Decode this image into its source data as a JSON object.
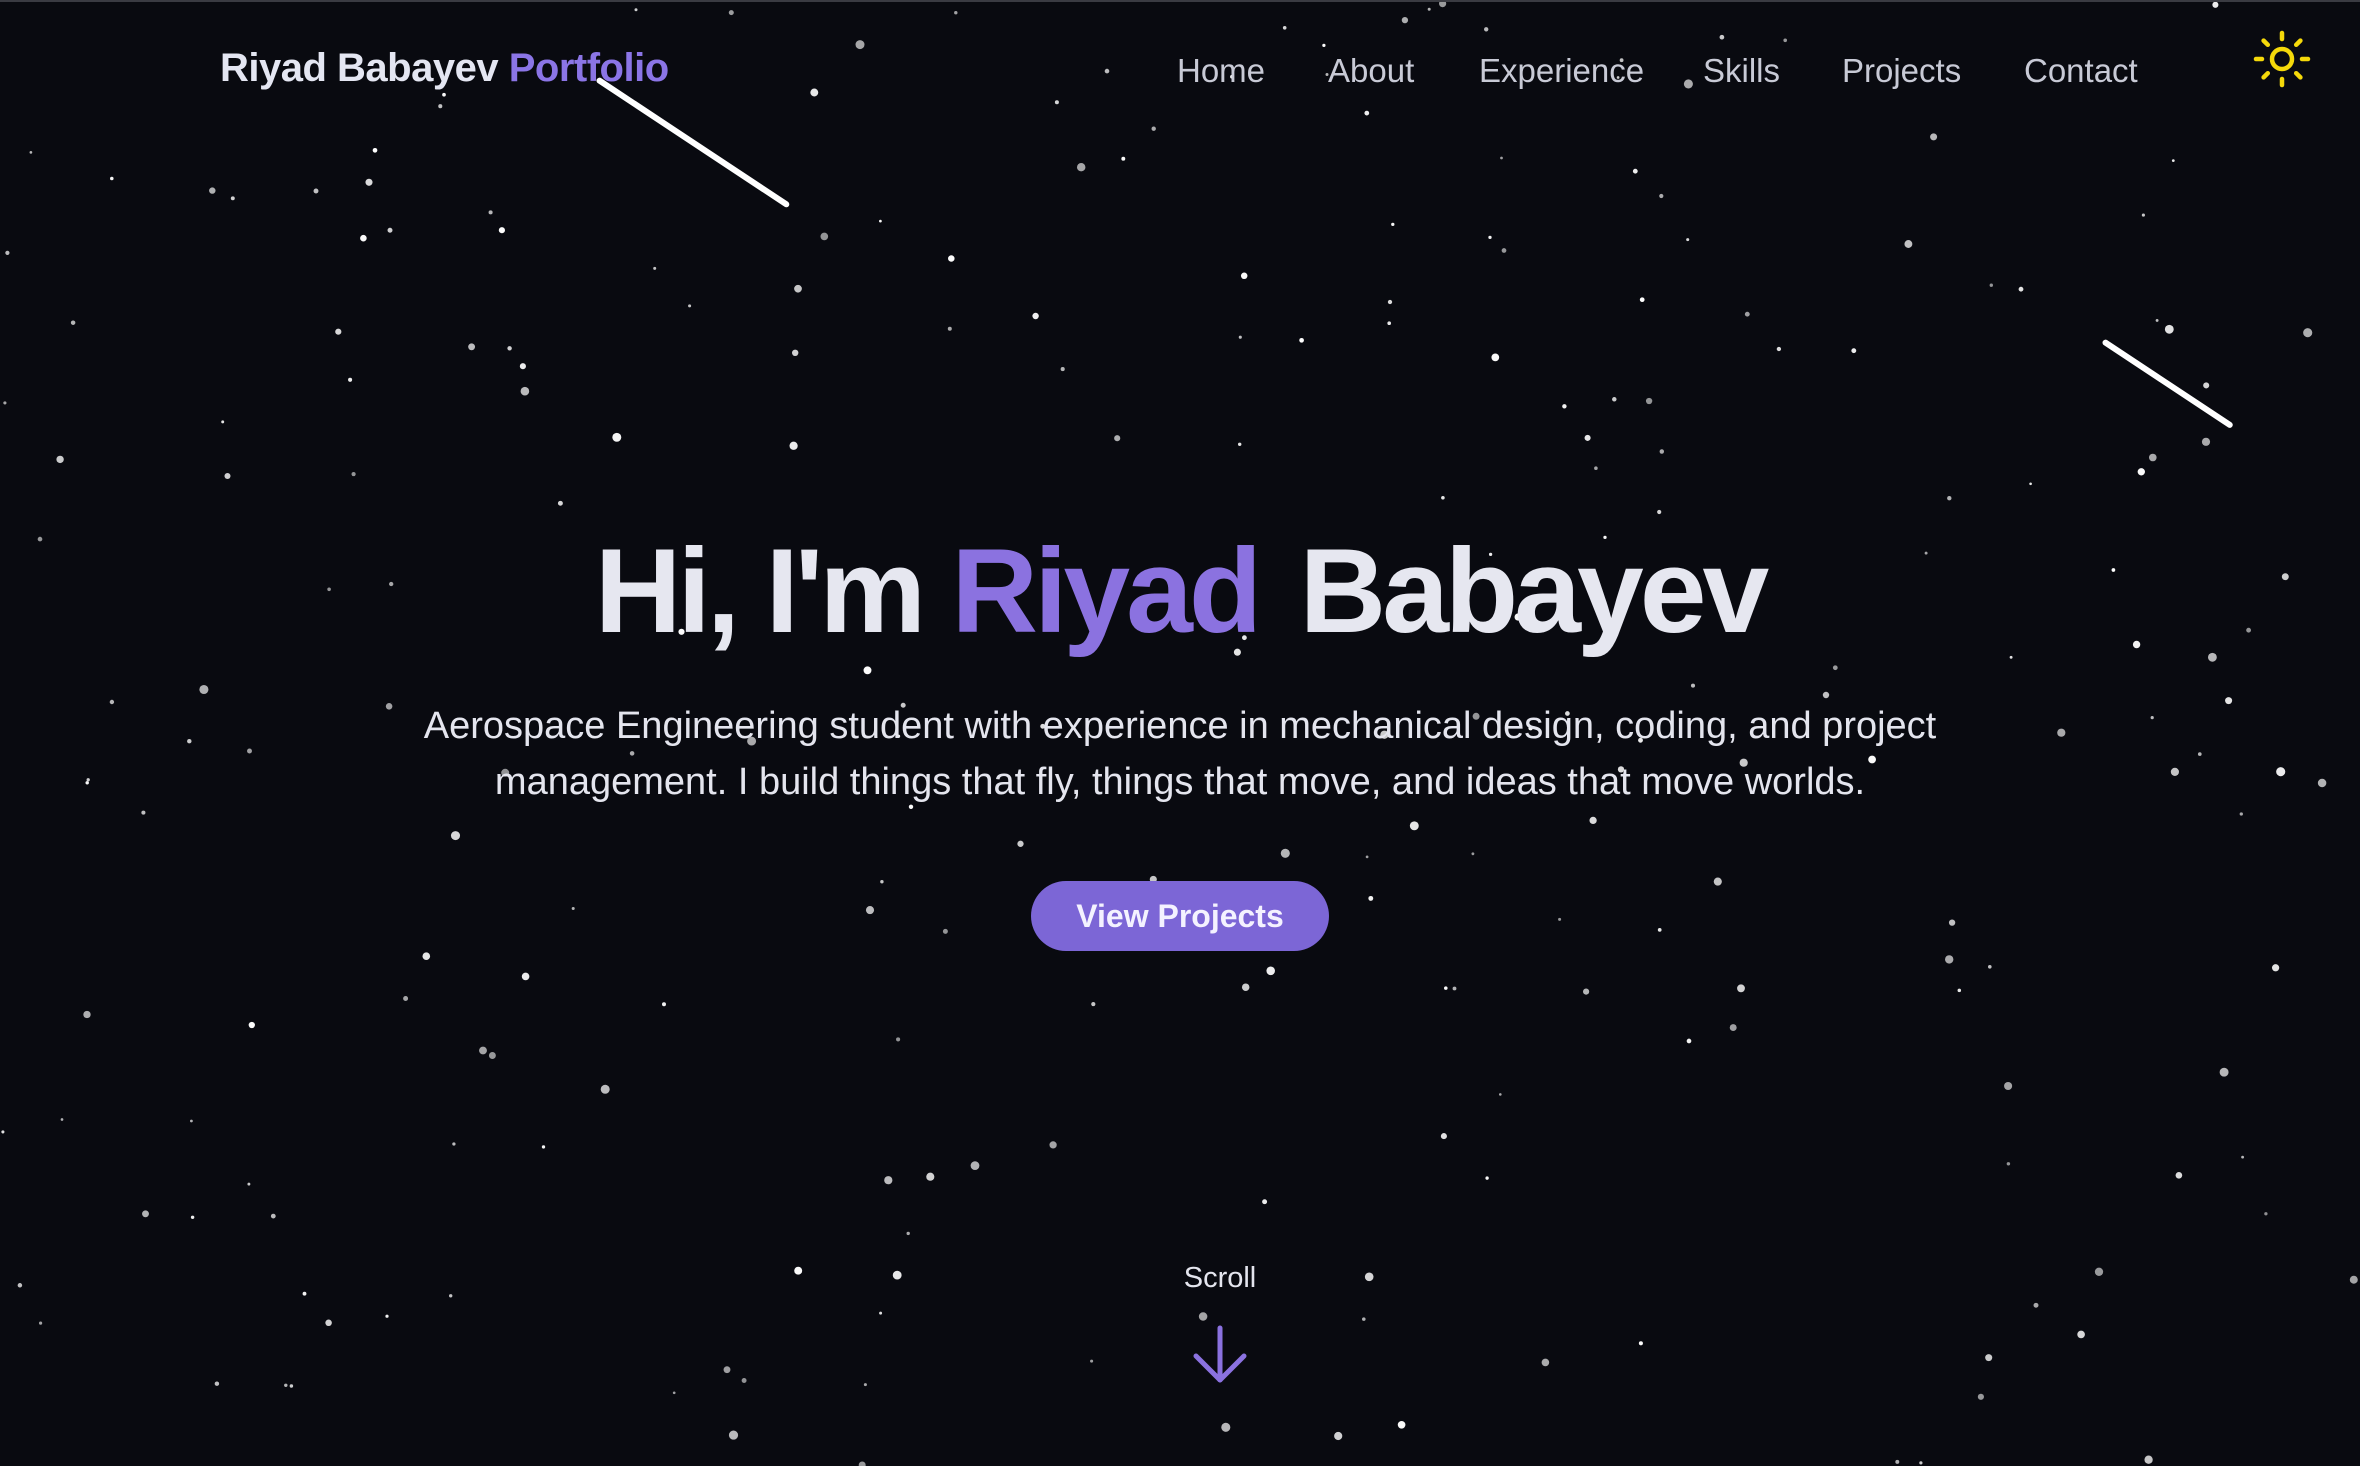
{
  "brand": {
    "name": "Riyad Babayev",
    "accent": "Portfolio"
  },
  "nav": {
    "items": [
      {
        "label": "Home"
      },
      {
        "label": "About"
      },
      {
        "label": "Experience"
      },
      {
        "label": "Skills"
      },
      {
        "label": "Projects"
      },
      {
        "label": "Contact"
      }
    ]
  },
  "theme_toggle": {
    "icon": "sun-icon"
  },
  "hero": {
    "greeting": "Hi, I'm",
    "first_name": "Riyad",
    "last_name": "Babayev",
    "subtitle": "Aerospace Engineering student with experience in mechanical design, coding, and project management. I build things that fly, things that move, and ideas that move worlds.",
    "cta_label": "View Projects"
  },
  "scroll": {
    "label": "Scroll",
    "icon": "arrow-down-icon"
  },
  "colors": {
    "background": "#090a10",
    "accent": "#8b72e0",
    "button": "#7c66d6",
    "sun": "#f5d90a",
    "text": "#e6e7f0",
    "nav_text": "#c8cad6"
  }
}
